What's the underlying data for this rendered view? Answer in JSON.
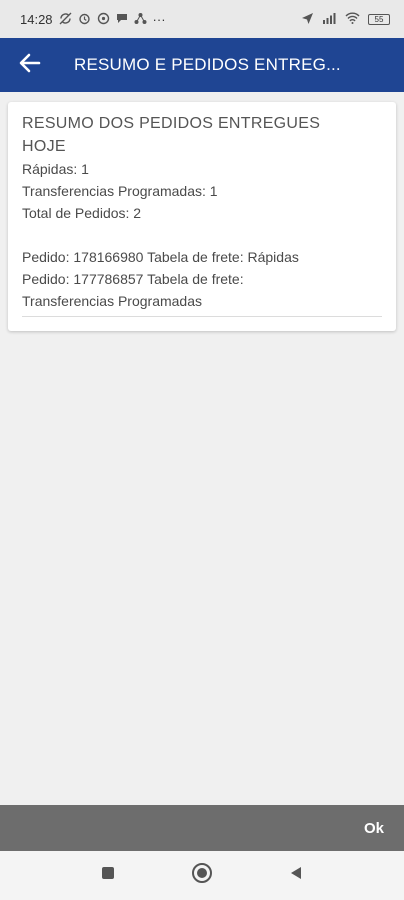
{
  "status_bar": {
    "time": "14:28",
    "dots": "···",
    "battery": "55"
  },
  "app_bar": {
    "title": "RESUMO E PEDIDOS ENTREG..."
  },
  "card": {
    "title_line1": "RESUMO DOS PEDIDOS ENTREGUES",
    "title_line2": "HOJE",
    "lines": [
      "Rápidas: 1",
      "Transferencias Programadas: 1",
      "Total de Pedidos: 2"
    ],
    "orders": [
      "Pedido: 178166980 Tabela de frete: Rápidas",
      "Pedido: 177786857 Tabela de frete:",
      "Transferencias Programadas"
    ]
  },
  "bottom": {
    "ok_label": "Ok"
  },
  "colors": {
    "app_bar": "#1f4593",
    "bottom_bar": "#6d6d6d",
    "background": "#f0f0f0"
  }
}
